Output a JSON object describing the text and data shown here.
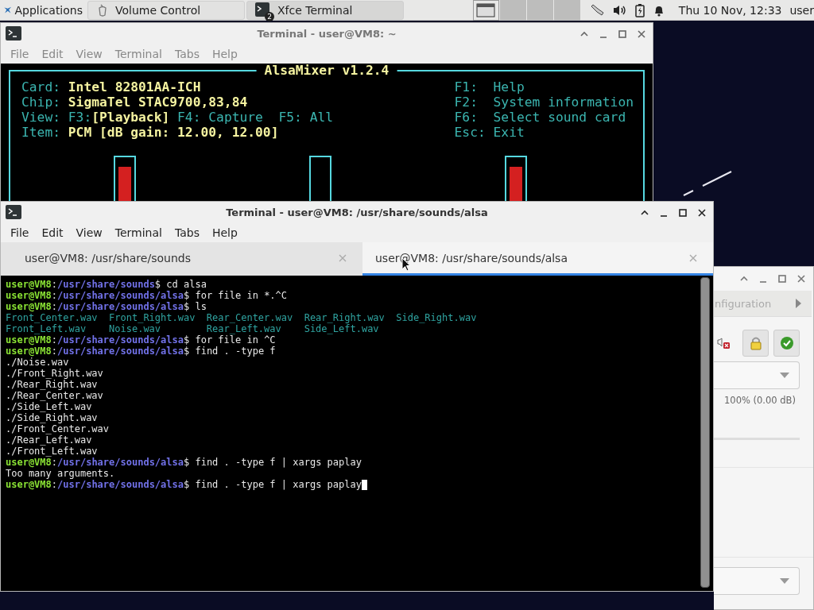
{
  "panel": {
    "applications": "Applications",
    "tasks": [
      {
        "label": "Volume Control",
        "kind": "volume",
        "selected": false
      },
      {
        "label": "Xfce Terminal",
        "kind": "terminal",
        "badge": "2",
        "selected": true
      }
    ],
    "workspaces": [
      {
        "selected": true
      },
      {
        "selected": false
      },
      {
        "selected": false
      },
      {
        "selected": false
      }
    ],
    "clock": "Thu 10 Nov, 12:33",
    "user": "user"
  },
  "back_terminal": {
    "title": "Terminal - user@VM8: ~",
    "menu": [
      "File",
      "Edit",
      "View",
      "Terminal",
      "Tabs",
      "Help"
    ],
    "alsamixer": {
      "title": "AlsaMixer v1.2.4",
      "info": [
        {
          "label": "Card:",
          "parts": [
            {
              "text": "Intel 82801AA-ICH",
              "kind": "value"
            }
          ]
        },
        {
          "label": "Chip:",
          "parts": [
            {
              "text": "SigmaTel STAC9700,83,84",
              "kind": "value"
            }
          ]
        },
        {
          "label": "View:",
          "parts": [
            {
              "text": "F3:",
              "kind": "key"
            },
            {
              "text": "[Playback]",
              "kind": "value"
            },
            {
              "text": " F4: Capture  F5: All",
              "kind": "key"
            }
          ]
        },
        {
          "label": "Item:",
          "parts": [
            {
              "text": "PCM [dB gain: 12.00, 12.00]",
              "kind": "value"
            }
          ]
        }
      ],
      "keys": [
        {
          "key": "F1:",
          "action": "Help"
        },
        {
          "key": "F2:",
          "action": "System information"
        },
        {
          "key": "F6:",
          "action": "Select sound card"
        },
        {
          "key": "Esc:",
          "action": "Exit"
        }
      ],
      "channels": [
        {
          "level": 0.8
        },
        {
          "level": 0
        },
        {
          "level": 0.8
        }
      ]
    }
  },
  "front_terminal": {
    "title": "Terminal - user@VM8: /usr/share/sounds/alsa",
    "menu": [
      "File",
      "Edit",
      "View",
      "Terminal",
      "Tabs",
      "Help"
    ],
    "tabs": [
      {
        "label": "user@VM8: /usr/share/sounds",
        "selected": false
      },
      {
        "label": "user@VM8: /usr/share/sounds/alsa",
        "selected": true
      }
    ],
    "lines": [
      {
        "kind": "prompt",
        "user": "user@VM8",
        "colon": ":",
        "path": "/usr/share/sounds",
        "dollar": "$",
        "command": "cd alsa",
        "cursor": false
      },
      {
        "kind": "prompt",
        "user": "user@VM8",
        "colon": ":",
        "path": "/usr/share/sounds/alsa",
        "dollar": "$",
        "command": "for file in *.^C",
        "cursor": false
      },
      {
        "kind": "prompt",
        "user": "user@VM8",
        "colon": ":",
        "path": "/usr/share/sounds/alsa",
        "dollar": "$",
        "command": "ls",
        "cursor": false
      },
      {
        "kind": "files",
        "files": [
          "Front_Center.wav",
          "Front_Right.wav",
          "Rear_Center.wav",
          "Rear_Right.wav",
          "Side_Right.wav"
        ]
      },
      {
        "kind": "files",
        "files": [
          "Front_Left.wav",
          "Noise.wav",
          "Rear_Left.wav",
          "Side_Left.wav"
        ]
      },
      {
        "kind": "prompt",
        "user": "user@VM8",
        "colon": ":",
        "path": "/usr/share/sounds/alsa",
        "dollar": "$",
        "command": "for file in ^C",
        "cursor": false
      },
      {
        "kind": "prompt",
        "user": "user@VM8",
        "colon": ":",
        "path": "/usr/share/sounds/alsa",
        "dollar": "$",
        "command": "find . -type f",
        "cursor": false
      },
      {
        "kind": "output",
        "text": "./Noise.wav"
      },
      {
        "kind": "output",
        "text": "./Front_Right.wav"
      },
      {
        "kind": "output",
        "text": "./Rear_Right.wav"
      },
      {
        "kind": "output",
        "text": "./Rear_Center.wav"
      },
      {
        "kind": "output",
        "text": "./Side_Left.wav"
      },
      {
        "kind": "output",
        "text": "./Side_Right.wav"
      },
      {
        "kind": "output",
        "text": "./Front_Center.wav"
      },
      {
        "kind": "output",
        "text": "./Rear_Left.wav"
      },
      {
        "kind": "output",
        "text": "./Front_Left.wav"
      },
      {
        "kind": "prompt",
        "user": "user@VM8",
        "colon": ":",
        "path": "/usr/share/sounds/alsa",
        "dollar": "$",
        "command": "find . -type f | xargs paplay",
        "cursor": false
      },
      {
        "kind": "output",
        "text": "Too many arguments."
      },
      {
        "kind": "prompt",
        "user": "user@VM8",
        "colon": ":",
        "path": "/usr/share/sounds/alsa",
        "dollar": "$",
        "command": "find . -type f | xargs paplay",
        "cursor": true
      }
    ]
  },
  "volume_window": {
    "tab_fragment": "nfiguration",
    "reading": "100% (0.00 dB)"
  }
}
